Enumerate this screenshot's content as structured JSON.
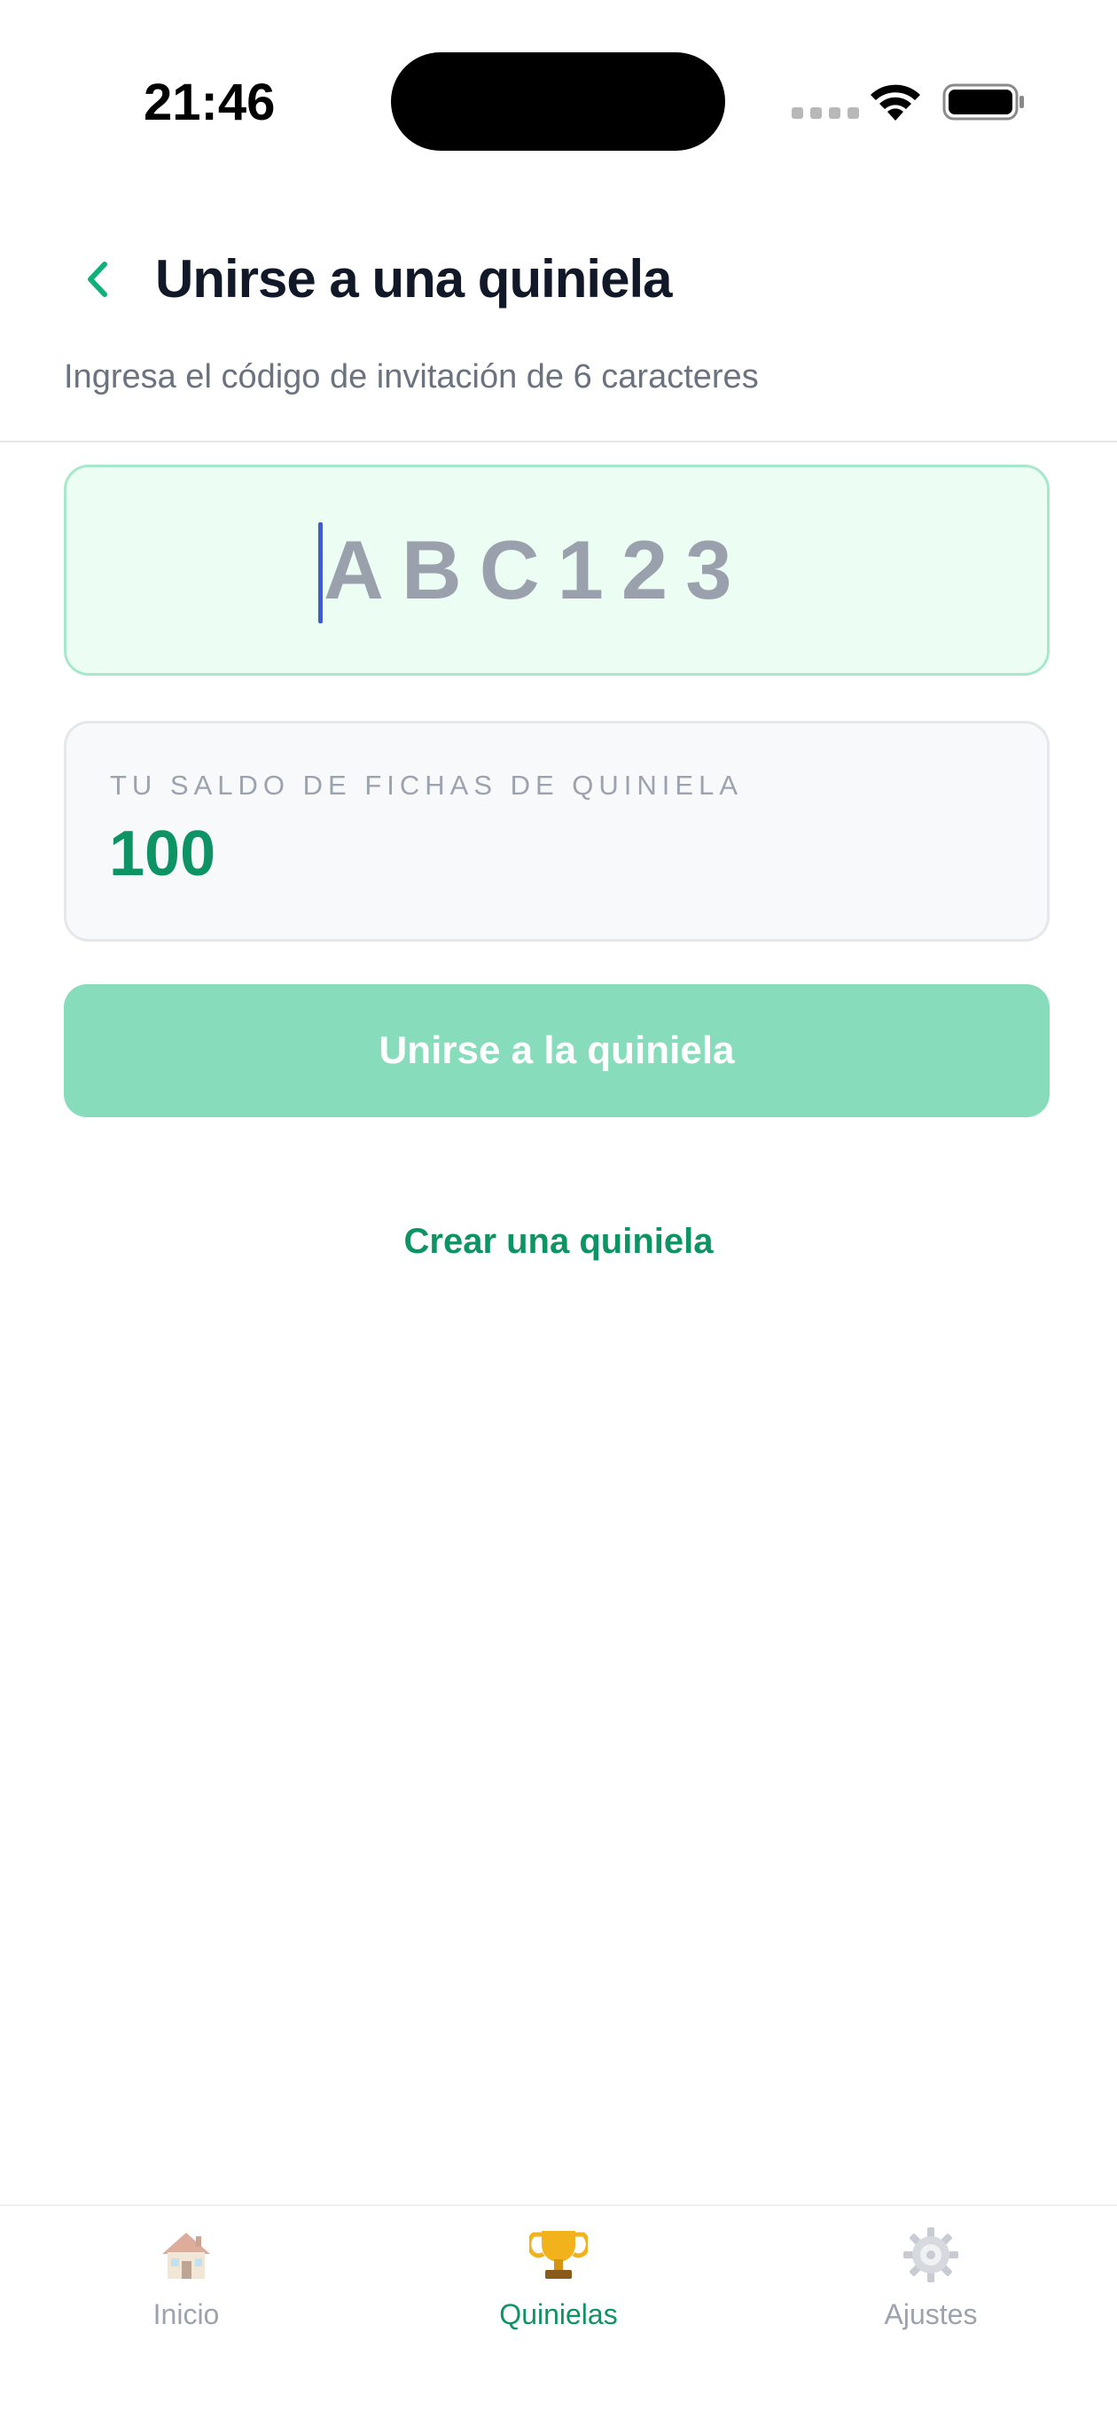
{
  "status_bar": {
    "time": "21:46"
  },
  "header": {
    "back_icon": "chevron-left-icon",
    "title": "Unirse a una quiniela",
    "subtitle": "Ingresa el código de invitación de 6 caracteres"
  },
  "code_input": {
    "placeholder": "ABC123",
    "value": ""
  },
  "balance": {
    "label": "TU SALDO DE FICHAS DE QUINIELA",
    "value": "100"
  },
  "actions": {
    "join_label": "Unirse a la quiniela",
    "create_label": "Crear una quiniela"
  },
  "tab_bar": {
    "items": [
      {
        "label": "Inicio",
        "icon": "house-icon",
        "active": false
      },
      {
        "label": "Quinielas",
        "icon": "trophy-icon",
        "active": true
      },
      {
        "label": "Ajustes",
        "icon": "gear-icon",
        "active": false
      }
    ]
  },
  "colors": {
    "accent": "#0e9464",
    "button_disabled": "#87ddbb",
    "input_bg": "#ecfdf4",
    "input_border": "#a7e8cc",
    "caret": "#3b5bdb"
  }
}
